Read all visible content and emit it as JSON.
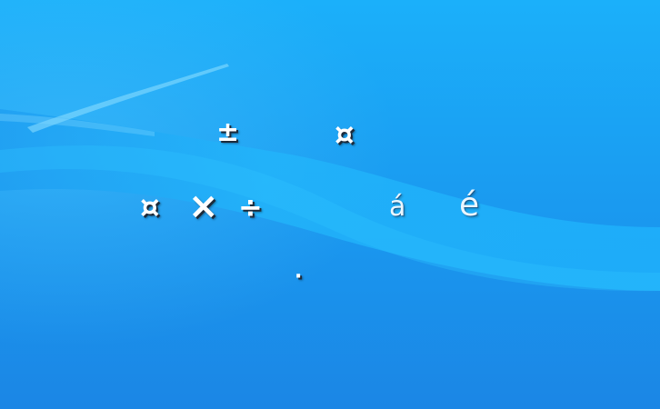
{
  "desktop": {
    "background": {
      "top_color": "#1ab2fb",
      "bottom_color": "#1b87e6",
      "wave_color": "#2cc0ff"
    },
    "glyphs": {
      "row1_a": "±",
      "row1_b": "¤",
      "row2_a": "¤",
      "row2_b": "×",
      "row2_c": "÷",
      "row2_d": "á",
      "row2_e": "é",
      "row3_a": "·"
    }
  }
}
